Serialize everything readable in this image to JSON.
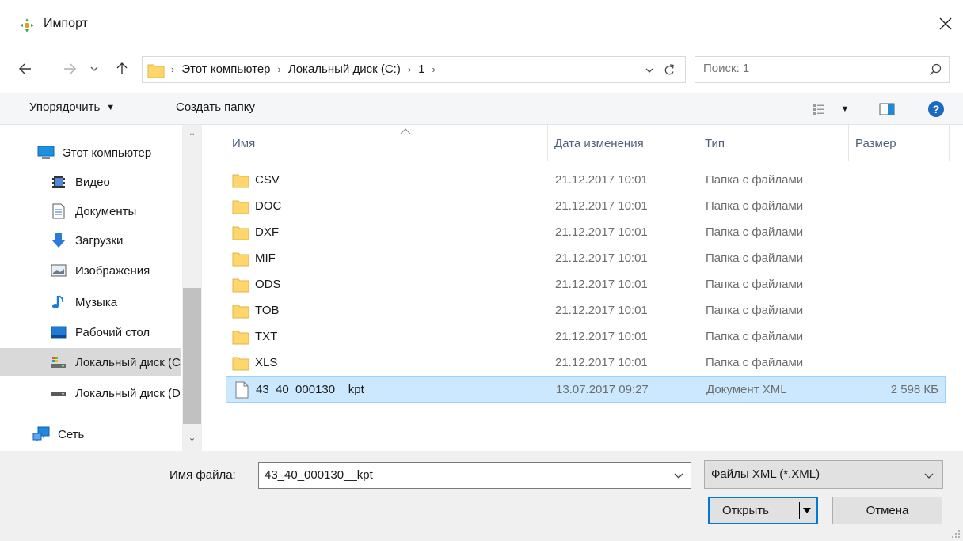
{
  "window": {
    "title": "Импорт"
  },
  "address": {
    "crumbs": [
      "Этот компьютер",
      "Локальный диск (C:)",
      "1"
    ]
  },
  "search": {
    "placeholder": "Поиск: 1"
  },
  "toolbar": {
    "organize_label": "Упорядочить",
    "new_folder_label": "Создать папку"
  },
  "nav": {
    "items": [
      {
        "label": "Этот компьютер",
        "icon": "computer-icon"
      },
      {
        "label": "Видео",
        "icon": "video-icon"
      },
      {
        "label": "Документы",
        "icon": "documents-icon"
      },
      {
        "label": "Загрузки",
        "icon": "downloads-icon"
      },
      {
        "label": "Изображения",
        "icon": "pictures-icon"
      },
      {
        "label": "Музыка",
        "icon": "music-icon"
      },
      {
        "label": "Рабочий стол",
        "icon": "desktop-icon"
      },
      {
        "label": "Локальный диск (C:)",
        "icon": "local-disk-icon"
      },
      {
        "label": "Локальный диск (D:)",
        "icon": "drive-icon"
      },
      {
        "label": "Сеть",
        "icon": "network-icon"
      }
    ]
  },
  "columns": {
    "name": "Имя",
    "date": "Дата изменения",
    "type": "Тип",
    "size": "Размер"
  },
  "files": [
    {
      "name": "CSV",
      "date": "21.12.2017 10:01",
      "type": "Папка с файлами",
      "size": "",
      "kind": "folder"
    },
    {
      "name": "DOC",
      "date": "21.12.2017 10:01",
      "type": "Папка с файлами",
      "size": "",
      "kind": "folder"
    },
    {
      "name": "DXF",
      "date": "21.12.2017 10:01",
      "type": "Папка с файлами",
      "size": "",
      "kind": "folder"
    },
    {
      "name": "MIF",
      "date": "21.12.2017 10:01",
      "type": "Папка с файлами",
      "size": "",
      "kind": "folder"
    },
    {
      "name": "ODS",
      "date": "21.12.2017 10:01",
      "type": "Папка с файлами",
      "size": "",
      "kind": "folder"
    },
    {
      "name": "TOB",
      "date": "21.12.2017 10:01",
      "type": "Папка с файлами",
      "size": "",
      "kind": "folder"
    },
    {
      "name": "TXT",
      "date": "21.12.2017 10:01",
      "type": "Папка с файлами",
      "size": "",
      "kind": "folder"
    },
    {
      "name": "XLS",
      "date": "21.12.2017 10:01",
      "type": "Папка с файлами",
      "size": "",
      "kind": "folder"
    },
    {
      "name": "43_40_000130__kpt",
      "date": "13.07.2017 09:27",
      "type": "Документ XML",
      "size": "2 598 КБ",
      "kind": "file"
    }
  ],
  "footer": {
    "filename_label": "Имя файла:",
    "filename_value": "43_40_000130__kpt",
    "filter_value": "Файлы XML (*.XML)",
    "open_label": "Открыть",
    "cancel_label": "Отмена"
  },
  "colors": {
    "accent": "#0078d7",
    "selection_bg": "#cce8ff",
    "selection_border": "#99d1ff",
    "folder": "#ffd66b"
  }
}
